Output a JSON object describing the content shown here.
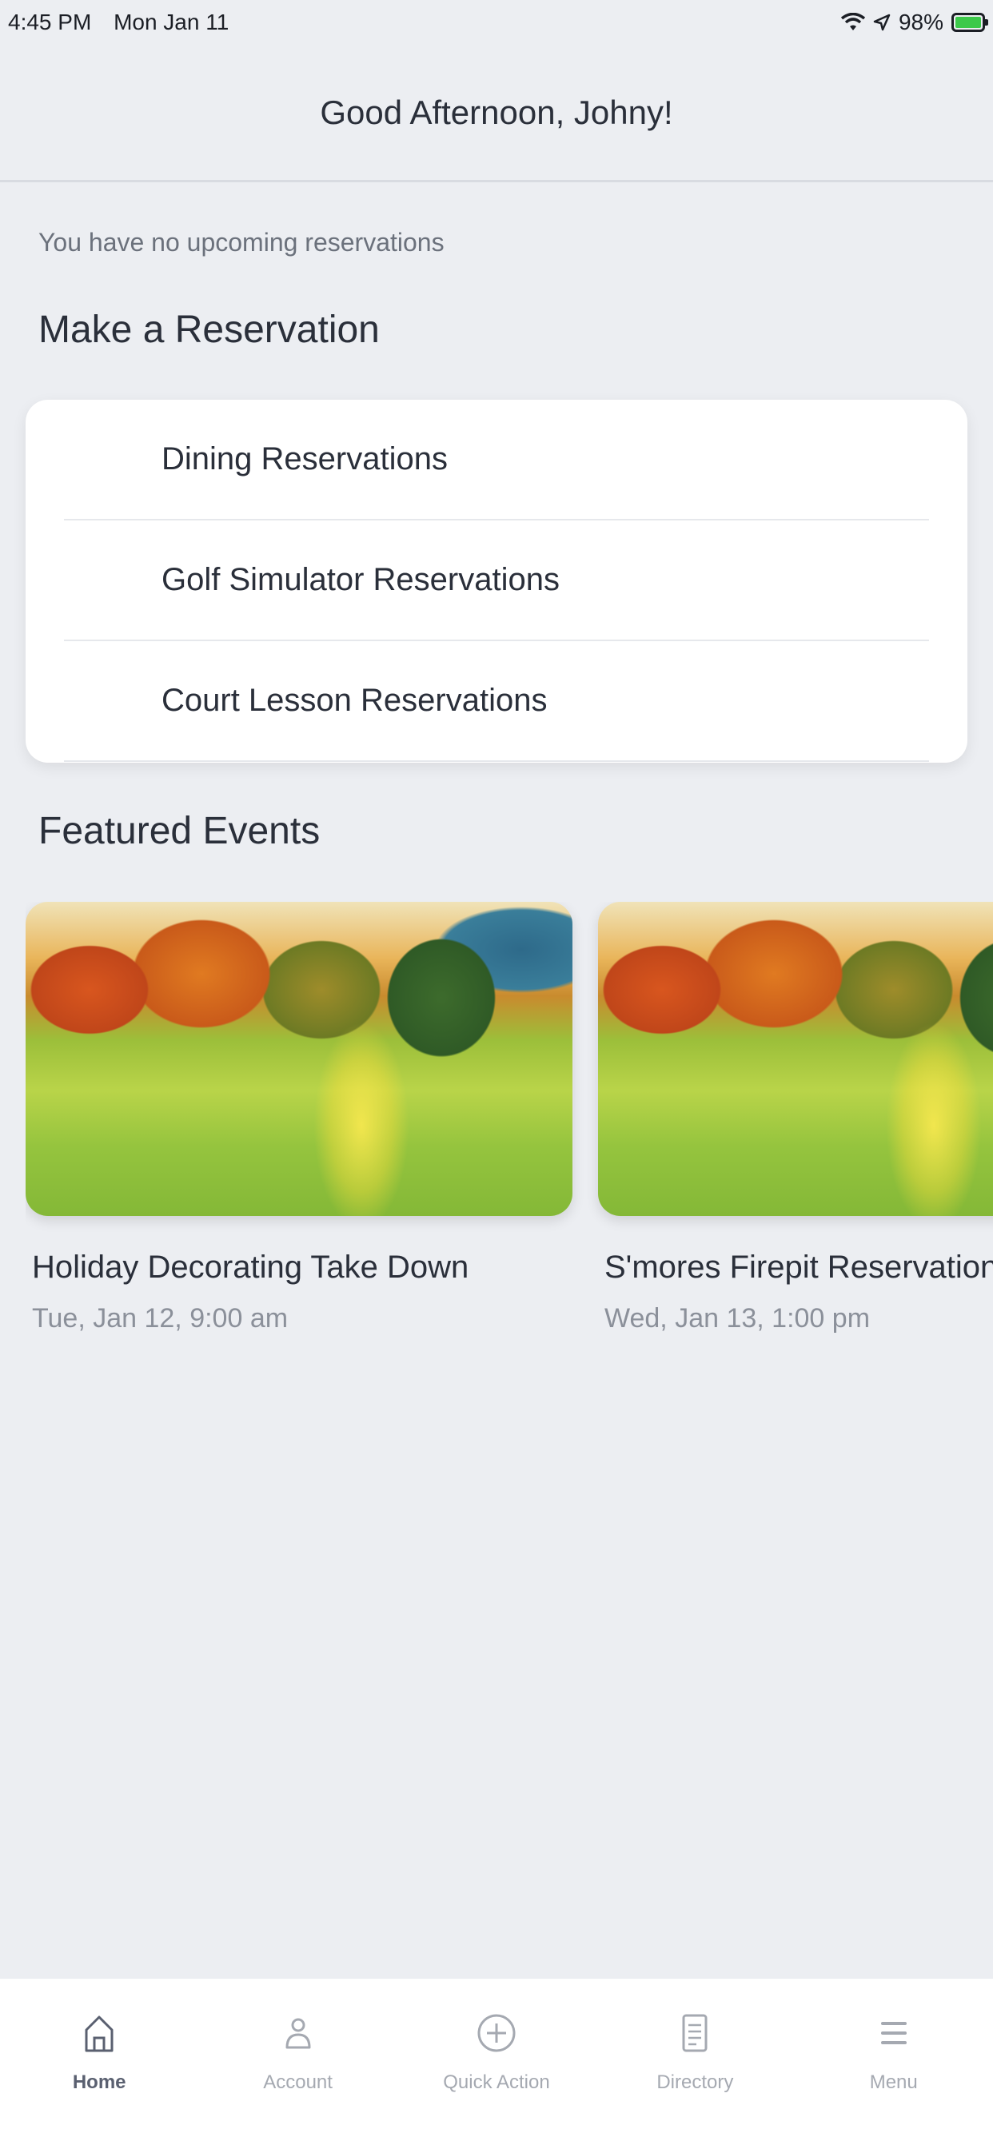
{
  "status_bar": {
    "time": "4:45 PM",
    "date": "Mon Jan 11",
    "battery": "98%"
  },
  "header": {
    "title": "Good Afternoon, Johny!"
  },
  "reservations": {
    "empty_message": "You have no upcoming reservations",
    "section_title": "Make a Reservation",
    "items": [
      {
        "label": "Dining Reservations"
      },
      {
        "label": "Golf Simulator Reservations"
      },
      {
        "label": "Court Lesson Reservations"
      }
    ]
  },
  "featured": {
    "section_title": "Featured Events",
    "events": [
      {
        "title": "Holiday Decorating Take Down",
        "date": "Tue, Jan 12, 9:00 am",
        "image_icon": "golf-course-image"
      },
      {
        "title": "S'mores Firepit Reservation",
        "date": "Wed, Jan 13, 1:00 pm",
        "image_icon": "golf-course-image"
      }
    ]
  },
  "tab_bar": {
    "tabs": [
      {
        "label": "Home",
        "icon": "home-icon",
        "active": true
      },
      {
        "label": "Account",
        "icon": "account-icon",
        "active": false
      },
      {
        "label": "Quick Action",
        "icon": "plus-circle-icon",
        "active": false
      },
      {
        "label": "Directory",
        "icon": "directory-icon",
        "active": false
      },
      {
        "label": "Menu",
        "icon": "menu-icon",
        "active": false
      }
    ]
  },
  "colors": {
    "background": "#eceef2",
    "card": "#ffffff",
    "text_primary": "#2a2f3a",
    "text_secondary": "#8b909a",
    "battery_green": "#3cc94a"
  }
}
